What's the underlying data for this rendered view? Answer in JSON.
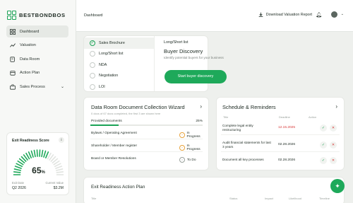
{
  "brand": {
    "name": "BESTBONDBOS",
    "accent": "#1ea95a"
  },
  "sidebar": {
    "items": [
      {
        "label": "Dashboard",
        "icon": "grid-icon",
        "active": true
      },
      {
        "label": "Valuation",
        "icon": "trend-icon"
      },
      {
        "label": "Data Room",
        "icon": "folder-icon"
      },
      {
        "label": "Action Plan",
        "icon": "calendar-icon"
      },
      {
        "label": "Sales Process",
        "icon": "briefcase-icon",
        "has_children": true
      }
    ]
  },
  "score": {
    "title": "Exit Readiness Score",
    "value": "65",
    "unit": "%",
    "exit_date_label": "Exit Date",
    "exit_date": "Q2 2026",
    "current_value_label": "Current Value",
    "current_value": "$3.2M"
  },
  "header": {
    "title": "Dashboard",
    "download_label": "Download Valuation Report"
  },
  "steps": {
    "items": [
      {
        "label": "Sales Brochure",
        "done": true
      },
      {
        "label": "Long/Short list",
        "done": false
      },
      {
        "label": "NDA",
        "done": false
      },
      {
        "label": "Negotiation",
        "done": false
      },
      {
        "label": "LOI",
        "done": false
      }
    ],
    "current_label": "Long/Short list",
    "current_title": "Buyer Discovery",
    "current_desc": "Identify potential buyers for your business",
    "button_label": "Start buyer discovery"
  },
  "data_room": {
    "title": "Data Room Document Collection Wizard",
    "subtitle": "0 docs of 67 docs completed, the first 3 are shown here",
    "progress_label": "Provided documents",
    "progress_pct": "25%",
    "progress_value": 0.25,
    "rows": [
      {
        "name": "Bylaws / Operating Agreement",
        "status": "In Progress"
      },
      {
        "name": "Shareholder / Member register",
        "status": "In Progress"
      },
      {
        "name": "Board or Member Resolutions",
        "status": "To Do"
      }
    ]
  },
  "schedule": {
    "title": "Schedule & Reminders",
    "headers": {
      "title": "Title",
      "deadline": "Deadline",
      "action": "Action"
    },
    "rows": [
      {
        "task": "Complete legal entity restructuring",
        "date": "12.15.2025",
        "overdue": true
      },
      {
        "task": "Audit financial statements for last 3 years",
        "date": "02.28.2026",
        "overdue": false
      },
      {
        "task": "Document all key processes",
        "date": "02.28.2026",
        "overdue": false
      }
    ]
  },
  "action_plan": {
    "title": "Exit Readiness Action Plan",
    "headers": {
      "title": "Title",
      "status": "Status",
      "impact": "Impact",
      "likelihood": "Likelihood",
      "timeline": "Timeline"
    }
  }
}
